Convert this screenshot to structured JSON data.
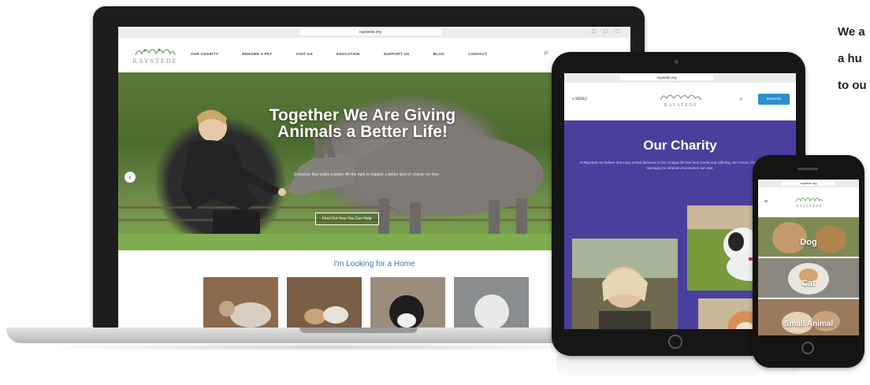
{
  "side_text": {
    "line1": "We a",
    "line2": "a hu",
    "line3": "to ou"
  },
  "laptop": {
    "browser": {
      "url": "raystede.org",
      "icons": "☐ ☐ ☐"
    },
    "logo_text": "RAYSTEDE",
    "nav": [
      "OUR CHARITY",
      "REHOME A PET",
      "VISIT US",
      "EDUCATION",
      "SUPPORT US",
      "BLOG",
      "CONTACT"
    ],
    "hero": {
      "title": "Together We Are Giving Animals a Better Life!",
      "subtitle": "Everyone that walks a better life the right to happier a better kind of chance for love",
      "cta": "Find Out How You Can Help"
    },
    "section_heading": "I'm Looking for a Home"
  },
  "tablet": {
    "url": "raystede.org",
    "menu_label": "≡ MENU",
    "logo_text": "RAYSTEDE",
    "donate": "DONATE",
    "title": "Our Charity",
    "body": "At Raystede we believe that every animal deserves to live a happy life free from cruelty and suffering. We rescue, rehome and provide sanctuary for all kinds of animals in our care."
  },
  "phone": {
    "url": "raystede.org",
    "logo_text": "RAYSTEDE",
    "cards": [
      "Dog",
      "Cat",
      "Small Animal"
    ]
  },
  "colors": {
    "brand_blue": "#3a78b5",
    "charity_purple": "#4b3f9e",
    "donate_blue": "#2a8fd0"
  }
}
